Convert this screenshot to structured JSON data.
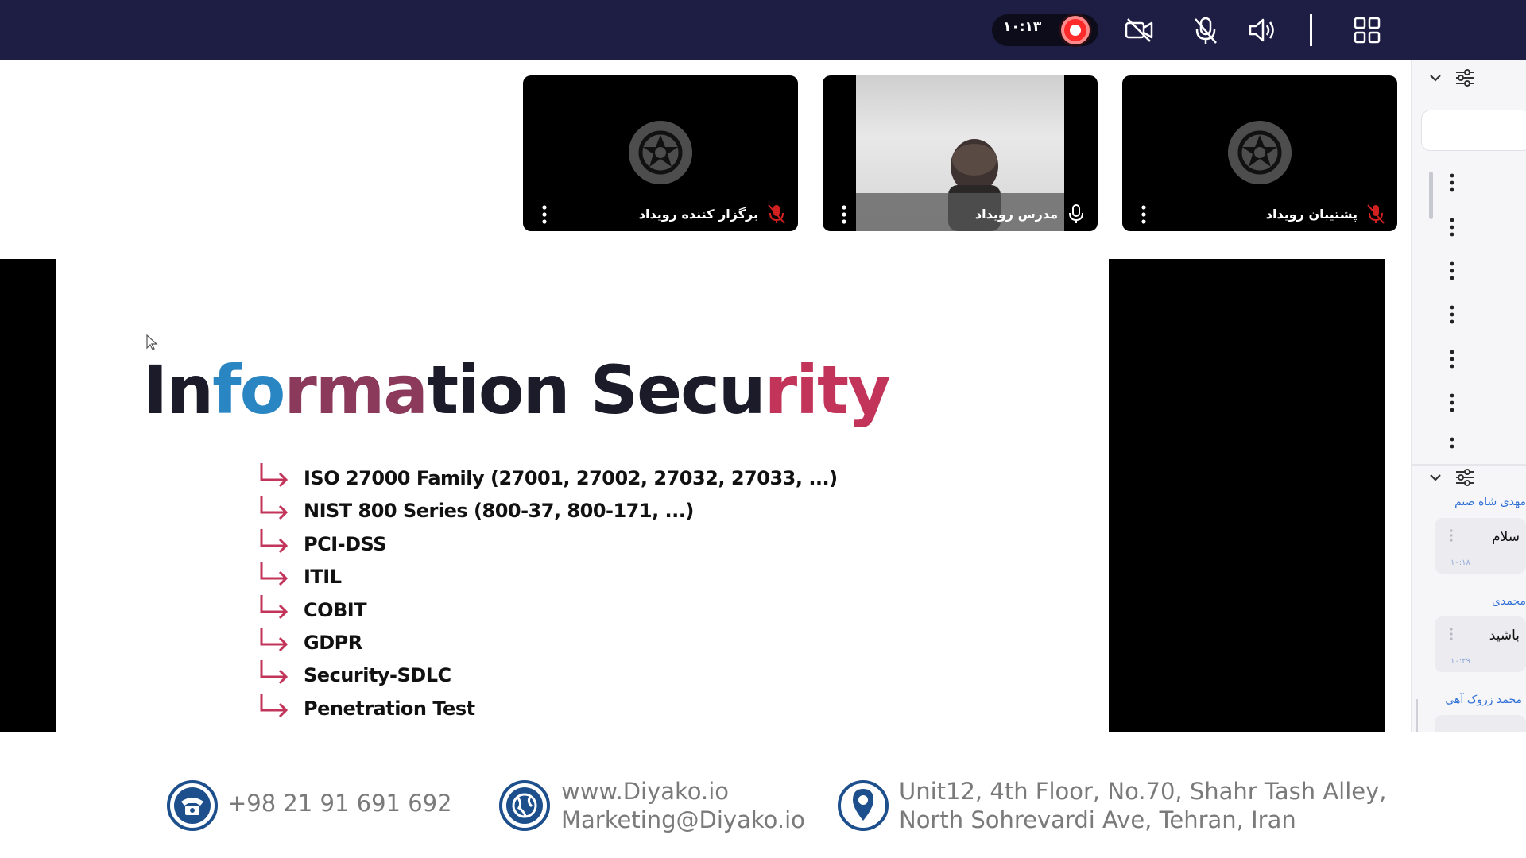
{
  "toolbar": {
    "timer": "۱۰:۱۳",
    "colors": {
      "bar": "#1e1e45",
      "record": "#ff2a2a"
    }
  },
  "participants": [
    {
      "name": "برگزار کننده رویداد",
      "mic": "muted"
    },
    {
      "name": "مدرس رویداد",
      "mic": "on",
      "video": "on"
    },
    {
      "name": "پشتیبان رویداد",
      "mic": "muted"
    }
  ],
  "slide": {
    "title_parts": [
      "In",
      "fo",
      "rma",
      "tion Secu",
      "rity"
    ],
    "items": [
      "ISO 27000 Family (27001, 27002, 27032, 27033, ...)",
      "NIST 800 Series (800-37, 800-171, ...)",
      "PCI-DSS",
      "ITIL",
      "COBIT",
      "GDPR",
      "Security-SDLC",
      "Penetration Test"
    ],
    "accent": "#c2345a"
  },
  "footer": {
    "phone": "+98 21 91 691 692",
    "website": "www.Diyako.io",
    "email": "Marketing@Diyako.io",
    "address_line1": "Unit12, 4th Floor, No.70, Shahr Tash Alley,",
    "address_line2": "North Sohrevardi Ave, Tehran, Iran"
  },
  "chat": {
    "messages": [
      {
        "sender": "مهدی شاه صنم",
        "text": "سلام",
        "time": "۱۰:۱۸"
      },
      {
        "sender": "محمدی",
        "text": "باشید",
        "time": "۱۰:۲۹"
      },
      {
        "sender": "محمد زروک آهی",
        "text": "",
        "time": ""
      }
    ]
  }
}
